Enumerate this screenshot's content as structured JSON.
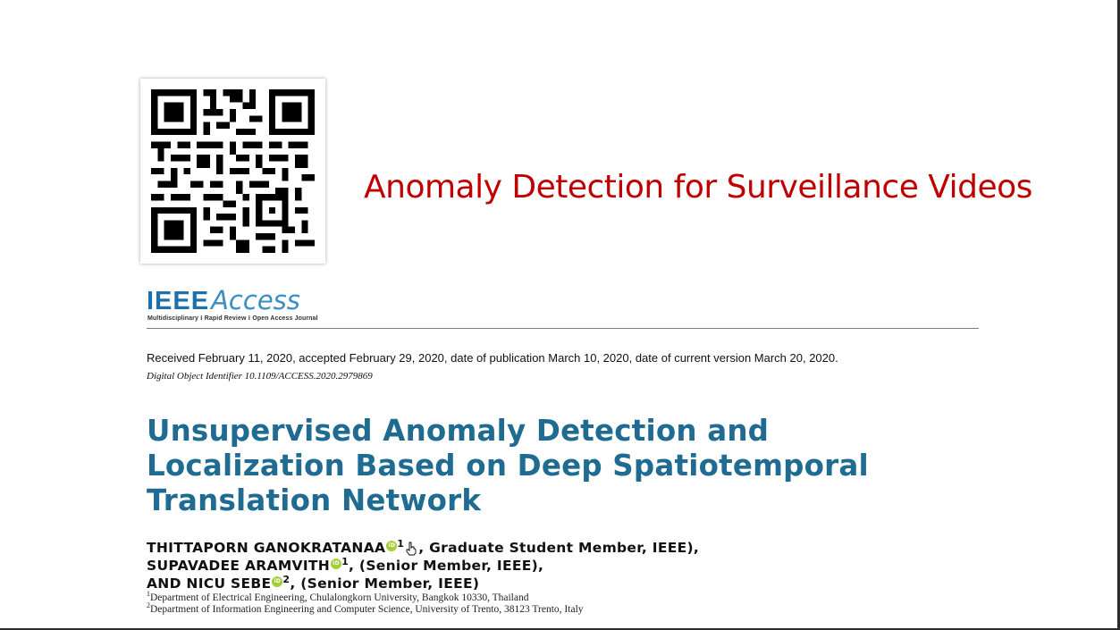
{
  "slide": {
    "title": "Anomaly Detection for Surveillance Videos"
  },
  "qr_code": {
    "icon": "qr-code-icon"
  },
  "paper": {
    "journal": {
      "name_ieee": "IEEE",
      "name_access": "Access",
      "tagline": "Multidisciplinary  ⁝  Rapid Review  ⁝  Open Access Journal",
      "brand_color": "#1f6fa8"
    },
    "received": "Received February 11, 2020, accepted February 29, 2020, date of publication March 10, 2020, date of current version March 20, 2020.",
    "doi": "Digital Object Identifier 10.1109/ACCESS.2020.2979869",
    "title_lines": [
      "Unsupervised Anomaly Detection and",
      "Localization Based on Deep Spatiotemporal",
      "Translation Network"
    ],
    "title_color": "#1f6b92",
    "authors": [
      {
        "name": "THITTAPORN GANOKRATANAA",
        "aff": "1",
        "role": ", Graduate Student Member, IEEE),"
      },
      {
        "name": "SUPAVADEE ARAMVITH",
        "aff": "1",
        "role": ", (Senior Member, IEEE),"
      },
      {
        "name": "AND NICU SEBE",
        "aff": "2",
        "role": ", (Senior Member, IEEE)"
      }
    ],
    "affiliations": [
      {
        "num": "1",
        "text": "Department of Electrical Engineering, Chulalongkorn University, Bangkok 10330, Thailand"
      },
      {
        "num": "2",
        "text": "Department of Information Engineering and Computer Science, University of Trento, 38123 Trento, Italy"
      }
    ],
    "orcid_icon": "orcid-icon",
    "orcid_color": "#a6ce39"
  },
  "accent_color": "#c00000"
}
